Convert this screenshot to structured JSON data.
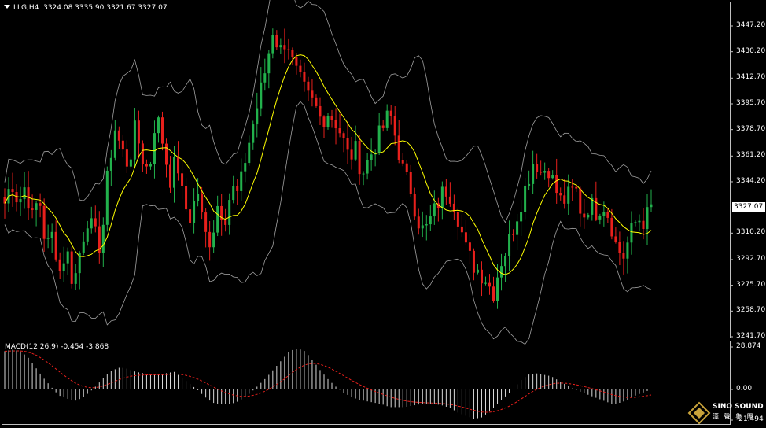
{
  "window": {
    "symbol_timeframe": "LLG,H4",
    "ohlc": "3324.08 3335.90 3321.67 3327.07"
  },
  "price_axis": {
    "ticks": [
      "3447.20",
      "3430.20",
      "3412.70",
      "3395.70",
      "3378.70",
      "3361.20",
      "3344.20",
      "3327.07",
      "3310.20",
      "3292.70",
      "3275.70",
      "3258.70",
      "3241.70"
    ],
    "current_price": "3327.07"
  },
  "macd": {
    "label": "MACD(12,26,9) -0.454 -3.868",
    "ticks": [
      "28.874",
      "0.00",
      "-21.494"
    ]
  },
  "watermark": {
    "brand": "SINO SOUND",
    "sub": "漢 聲 集 團"
  },
  "colors": {
    "bull": "#22b14c",
    "bear": "#e8201c",
    "ma": "#ffff00",
    "bands": "#a0a0a0",
    "signal": "#e8201c",
    "hist": "#d8d8d8"
  },
  "chart_data": {
    "type": "candlestick",
    "y_range": [
      3241.7,
      3464
    ],
    "close_path": [
      3330,
      3345,
      3330,
      3342,
      3320,
      3335,
      3300,
      3310,
      3285,
      3300,
      3275,
      3300,
      3320,
      3310,
      3300,
      3350,
      3380,
      3365,
      3355,
      3380,
      3360,
      3350,
      3390,
      3370,
      3345,
      3360,
      3330,
      3320,
      3340,
      3310,
      3305,
      3330,
      3320,
      3340,
      3335,
      3360,
      3380,
      3400,
      3420,
      3445,
      3430,
      3440,
      3420,
      3410,
      3400,
      3395,
      3385,
      3390,
      3385,
      3375,
      3360,
      3365,
      3350,
      3360,
      3370,
      3380,
      3390,
      3370,
      3350,
      3340,
      3320,
      3310,
      3320,
      3330,
      3340,
      3335,
      3320,
      3300,
      3290,
      3285,
      3280,
      3270,
      3290,
      3300,
      3315,
      3330,
      3345,
      3360,
      3350,
      3355,
      3340,
      3330,
      3335,
      3340,
      3320,
      3330,
      3325,
      3330,
      3320,
      3300,
      3295,
      3310,
      3320,
      3318,
      3327
    ],
    "macd_hist_path": [
      26,
      27,
      26,
      22,
      15,
      8,
      2,
      -4,
      -6,
      -8,
      -6,
      -2,
      3,
      9,
      13,
      15,
      14,
      12,
      11,
      10,
      10,
      11,
      12,
      8,
      4,
      0,
      -5,
      -9,
      -10,
      -10,
      -9,
      -6,
      -2,
      3,
      8,
      14,
      20,
      26,
      28,
      26,
      20,
      13,
      7,
      2,
      -2,
      -5,
      -7,
      -8,
      -9,
      -10,
      -12,
      -12,
      -12,
      -11,
      -10,
      -10,
      -10,
      -11,
      -13,
      -16,
      -18,
      -20,
      -19,
      -15,
      -10,
      -5,
      0,
      6,
      10,
      11,
      10,
      9,
      6,
      3,
      0,
      -2,
      -4,
      -6,
      -8,
      -10,
      -9,
      -7,
      -4,
      -2,
      0
    ],
    "ylabel": ""
  }
}
